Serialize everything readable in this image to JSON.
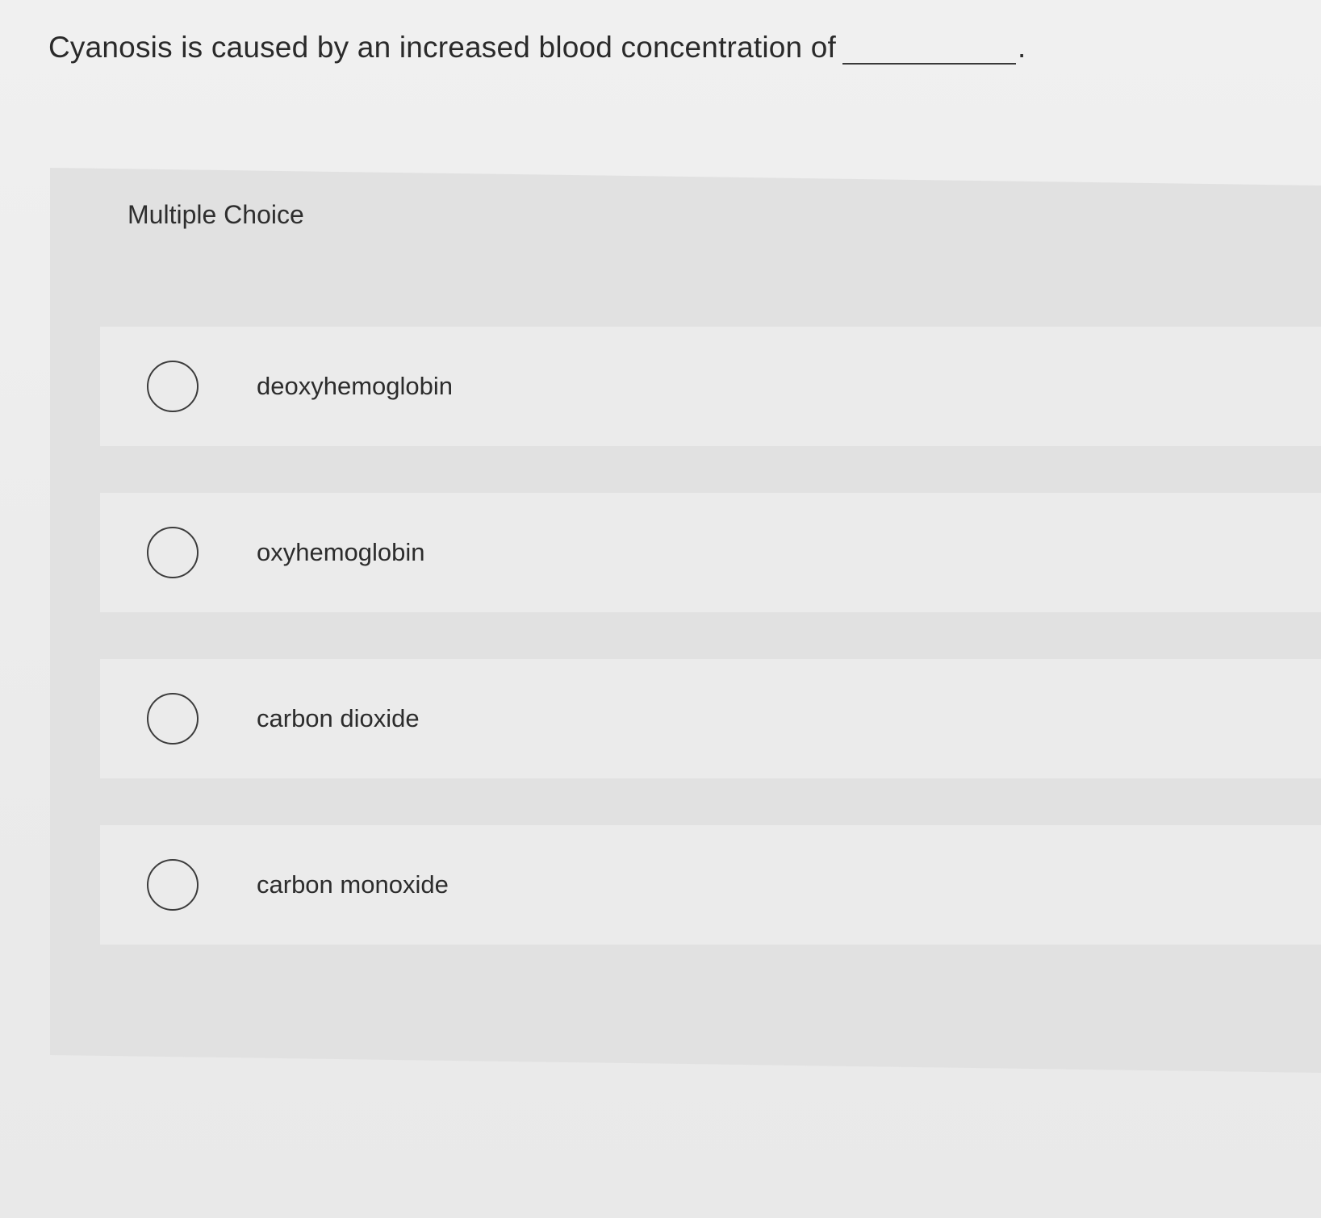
{
  "question": {
    "text": "Cyanosis is caused by an increased blood concentration of",
    "end_punctuation": "."
  },
  "multiple_choice": {
    "header": "Multiple Choice",
    "options": [
      {
        "label": "deoxyhemoglobin",
        "selected": false
      },
      {
        "label": "oxyhemoglobin",
        "selected": false
      },
      {
        "label": "carbon dioxide",
        "selected": false
      },
      {
        "label": "carbon monoxide",
        "selected": false
      }
    ]
  }
}
